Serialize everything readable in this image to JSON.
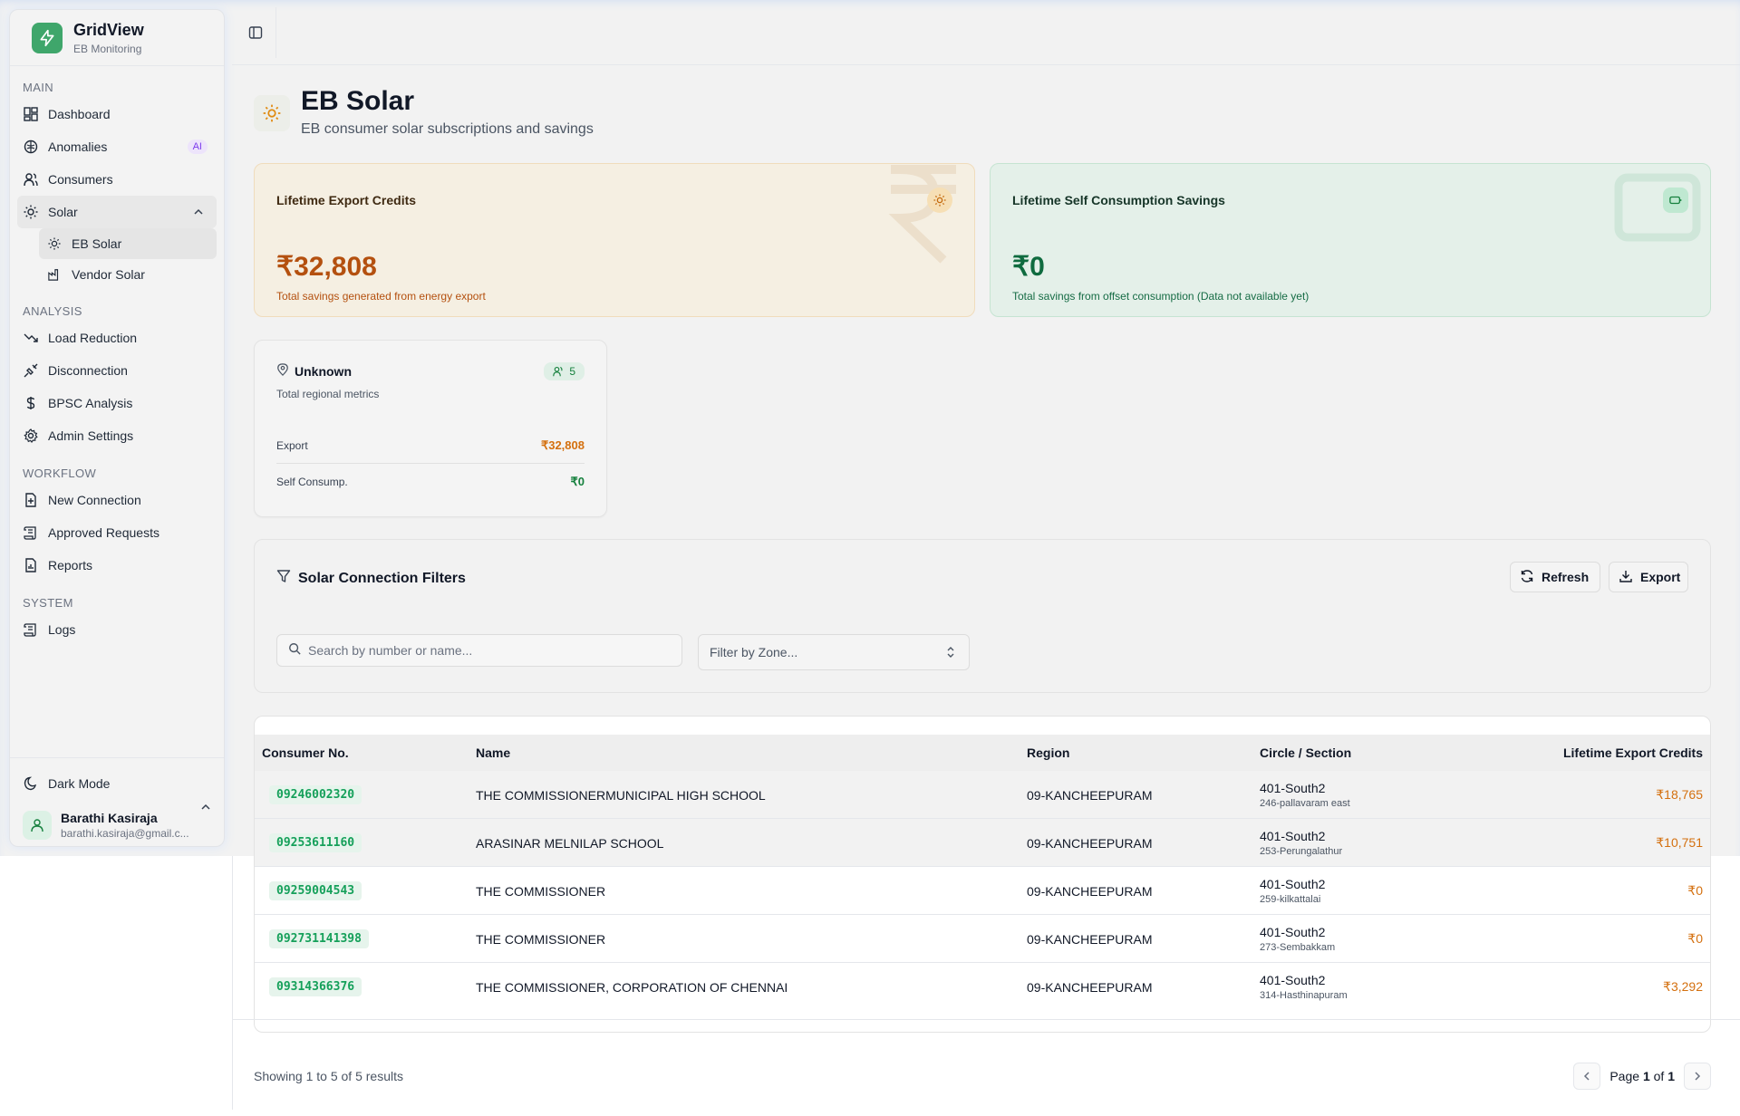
{
  "brand": {
    "title": "GridView",
    "subtitle": "EB Monitoring"
  },
  "sidebar": {
    "sections": {
      "main": "MAIN",
      "analysis": "ANALYSIS",
      "workflow": "WORKFLOW",
      "system": "SYSTEM"
    },
    "main_items": [
      {
        "label": "Dashboard",
        "icon": "dashboard-icon"
      },
      {
        "label": "Anomalies",
        "icon": "brain-icon",
        "badge": "AI"
      },
      {
        "label": "Consumers",
        "icon": "users-icon"
      },
      {
        "label": "Solar",
        "icon": "sun-icon",
        "expanded": true
      }
    ],
    "solar_sub": [
      {
        "label": "EB Solar",
        "icon": "sun-icon",
        "active": true
      },
      {
        "label": "Vendor Solar",
        "icon": "factory-icon"
      }
    ],
    "analysis_items": [
      {
        "label": "Load Reduction",
        "icon": "trending-down-icon"
      },
      {
        "label": "Disconnection",
        "icon": "unplug-icon"
      },
      {
        "label": "BPSC Analysis",
        "icon": "dollar-icon"
      },
      {
        "label": "Admin Settings",
        "icon": "gear-icon"
      }
    ],
    "workflow_items": [
      {
        "label": "New Connection",
        "icon": "file-plus-icon"
      },
      {
        "label": "Approved Requests",
        "icon": "scroll-icon"
      },
      {
        "label": "Reports",
        "icon": "report-icon"
      }
    ],
    "system_items": [
      {
        "label": "Logs",
        "icon": "scroll-icon"
      }
    ],
    "dark_mode": "Dark Mode",
    "user": {
      "name": "Barathi Kasiraja",
      "email": "barathi.kasiraja@gmail.c..."
    }
  },
  "page": {
    "title": "EB Solar",
    "subtitle": "EB consumer solar subscriptions and savings"
  },
  "stats": {
    "export": {
      "label": "Lifetime Export Credits",
      "value": "₹32,808",
      "desc": "Total savings generated from energy export"
    },
    "self": {
      "label": "Lifetime Self Consumption Savings",
      "value": "₹0",
      "desc": "Total savings from offset consumption (Data not available yet)"
    }
  },
  "region": {
    "name": "Unknown",
    "count": "5",
    "sub": "Total regional metrics",
    "export_label": "Export",
    "export_value": "₹32,808",
    "self_label": "Self Consump.",
    "self_value": "₹0"
  },
  "filters": {
    "title": "Solar Connection Filters",
    "refresh": "Refresh",
    "export": "Export",
    "search_placeholder": "Search by number or name...",
    "zone_placeholder": "Filter by Zone..."
  },
  "table": {
    "headers": [
      "Consumer No.",
      "Name",
      "Region",
      "Circle / Section",
      "Lifetime Export Credits"
    ],
    "rows": [
      {
        "no": "09246002320",
        "name": "THE COMMISSIONERMUNICIPAL HIGH SCHOOL",
        "region": "09-KANCHEEPURAM",
        "circle": "401-South2",
        "section": "246-pallavaram east",
        "credits": "₹18,765"
      },
      {
        "no": "09253611160",
        "name": "ARASINAR MELNILAP SCHOOL",
        "region": "09-KANCHEEPURAM",
        "circle": "401-South2",
        "section": "253-Perungalathur",
        "credits": "₹10,751"
      },
      {
        "no": "09259004543",
        "name": "THE COMMISSIONER",
        "region": "09-KANCHEEPURAM",
        "circle": "401-South2",
        "section": "259-kilkattalai",
        "credits": "₹0"
      },
      {
        "no": "092731141398",
        "name": "THE COMMISSIONER",
        "region": "09-KANCHEEPURAM",
        "circle": "401-South2",
        "section": "273-Sembakkam",
        "credits": "₹0"
      },
      {
        "no": "09314366376",
        "name": "THE COMMISSIONER, CORPORATION OF CHENNAI",
        "region": "09-KANCHEEPURAM",
        "circle": "401-South2",
        "section": "314-Hasthinapuram",
        "credits": "₹3,292"
      }
    ]
  },
  "footer": {
    "showing": "Showing 1 to 5 of 5 results",
    "page_prefix": "Page",
    "page_current": "1",
    "page_of": "of",
    "page_total": "1"
  },
  "colors": {
    "brand_green": "#3fa66b",
    "export_orange": "#b4500f",
    "savings_green": "#0f6b3f",
    "consumer_no_green": "#15a05a",
    "ai_badge_purple": "#7c3aed"
  }
}
